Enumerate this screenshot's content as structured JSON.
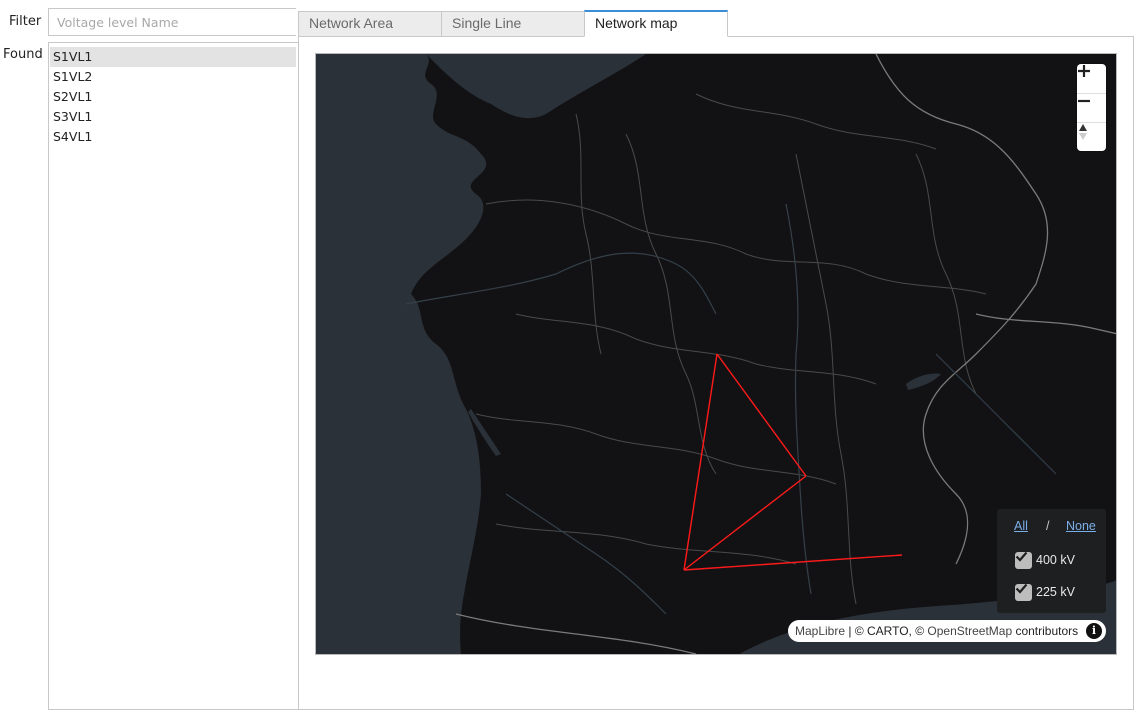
{
  "filter": {
    "label": "Filter",
    "placeholder": "Voltage level Name",
    "value": ""
  },
  "found": {
    "label": "Found",
    "items": [
      "S1VL1",
      "S1VL2",
      "S2VL1",
      "S3VL1",
      "S4VL1"
    ],
    "selected": "S1VL1"
  },
  "tabs": [
    {
      "label": "Network Area",
      "active": false
    },
    {
      "label": "Single Line",
      "active": false
    },
    {
      "label": "Network map",
      "active": true
    }
  ],
  "map": {
    "controls": {
      "zoom_in": "+",
      "zoom_out": "−",
      "compass_icon": "compass-icon"
    },
    "legend": {
      "all_label": "All",
      "separator": "/",
      "none_label": "None",
      "levels": [
        {
          "label": "400 kV",
          "checked": true
        },
        {
          "label": "225 kV",
          "checked": true
        }
      ]
    },
    "attribution": {
      "maplibre": "MapLibre",
      "separator": " | © CARTO, © ",
      "osm": "OpenStreetMap",
      "contributors": " contributors",
      "info_icon": "i"
    },
    "line_color": "#ff1a1a",
    "background_color": "#121214",
    "water_color": "#2b3138",
    "border_color": "#444444"
  }
}
